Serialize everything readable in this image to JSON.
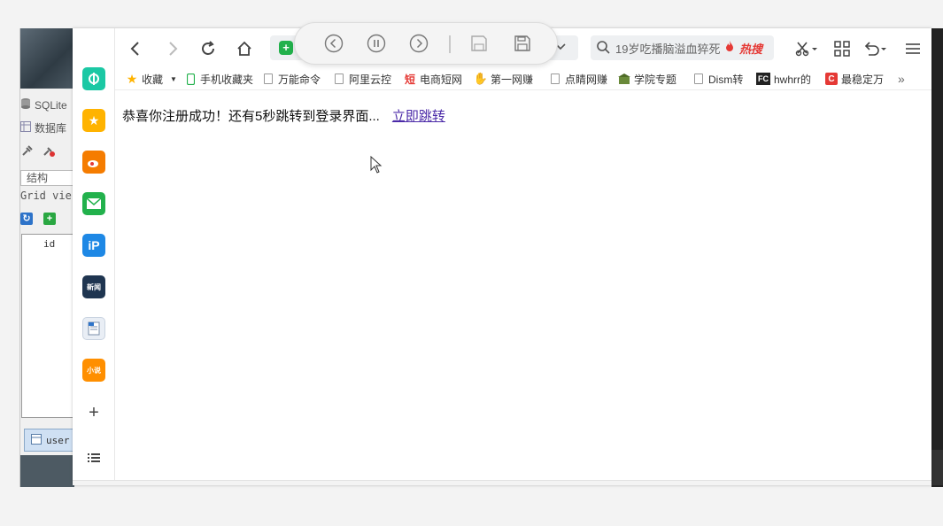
{
  "background_app": {
    "title": "SQLite",
    "db_label": "数据库",
    "struct_tab": "结构",
    "grid_label": "Grid vie",
    "column_header": "id",
    "table_tab": "user"
  },
  "browser": {
    "search": {
      "text": "19岁吃播脑溢血猝死",
      "hot_label": "热搜"
    },
    "bookmarks": [
      {
        "label": "收藏",
        "icon": "star-icon"
      },
      {
        "label": "手机收藏夹",
        "icon": "phone-icon"
      },
      {
        "label": "万能命令",
        "icon": "page-icon"
      },
      {
        "label": "阿里云控",
        "icon": "page-icon"
      },
      {
        "label": "电商短网",
        "icon": "short-link-icon"
      },
      {
        "label": "第一网赚",
        "icon": "hand-icon"
      },
      {
        "label": "点睛网赚",
        "icon": "page-icon"
      },
      {
        "label": "学院专题",
        "icon": "college-icon"
      },
      {
        "label": "Dism转",
        "icon": "page-icon"
      },
      {
        "label": "hwhrr的",
        "icon": "fc-icon"
      },
      {
        "label": "最稳定万",
        "icon": "c-icon"
      }
    ],
    "bookmarks_more": "»",
    "sidebar": [
      {
        "name": "sidebar-tool-icon",
        "color": "#1bc8a4"
      },
      {
        "name": "sidebar-favorites-icon",
        "color": "#ffb300"
      },
      {
        "name": "sidebar-weibo-icon",
        "color": "#f57c00"
      },
      {
        "name": "sidebar-mail-icon",
        "color": "#22b14c"
      },
      {
        "name": "sidebar-ip-icon",
        "color": "#1e88e5"
      },
      {
        "name": "sidebar-news-icon",
        "color": "#1f3550",
        "label": "新闻"
      },
      {
        "name": "sidebar-word-icon",
        "color": "#e9eef5"
      },
      {
        "name": "sidebar-novel-icon",
        "color": "#ff8f00",
        "label": "小说"
      }
    ]
  },
  "page": {
    "message": "恭喜你注册成功！还有5秒跳转到登录界面...",
    "link_text": "立即跳转"
  }
}
